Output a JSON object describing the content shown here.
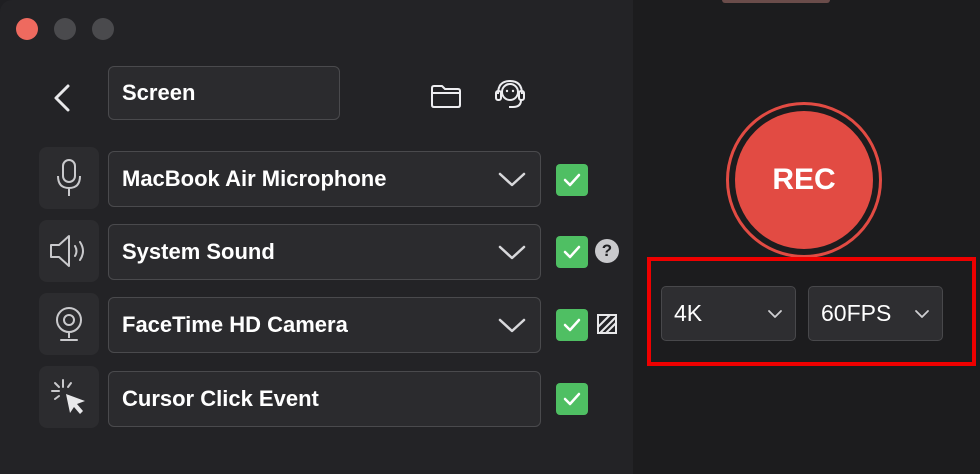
{
  "window": {
    "controls": [
      "close",
      "minimize",
      "maximize"
    ]
  },
  "header": {
    "mode_label": "Screen",
    "icons": [
      "back-chevron-icon",
      "folder-icon",
      "headset-support-icon"
    ]
  },
  "sources": [
    {
      "icon": "microphone-icon",
      "label": "MacBook Air Microphone",
      "has_dropdown": true,
      "checked": true
    },
    {
      "icon": "speaker-icon",
      "label": "System Sound",
      "has_dropdown": true,
      "checked": true,
      "extra": "help-icon"
    },
    {
      "icon": "webcam-icon",
      "label": "FaceTime HD Camera",
      "has_dropdown": true,
      "checked": true,
      "extra": "background-pattern-icon"
    },
    {
      "icon": "cursor-click-icon",
      "label": "Cursor Click Event",
      "has_dropdown": false,
      "checked": true
    }
  ],
  "help": {
    "glyph": "?"
  },
  "record": {
    "label": "REC",
    "color": "#e24b43"
  },
  "quality": {
    "resolution": "4K",
    "framerate": "60FPS"
  },
  "colors": {
    "check": "#4fbf63",
    "highlight": "#ee0000",
    "close": "#ee6a5f"
  }
}
